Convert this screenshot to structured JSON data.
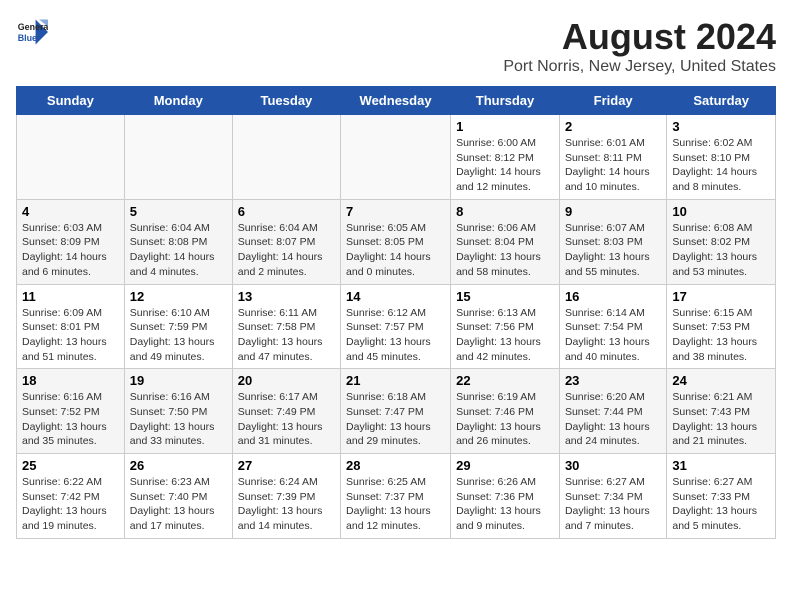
{
  "header": {
    "logo_line1": "General",
    "logo_line2": "Blue",
    "title": "August 2024",
    "subtitle": "Port Norris, New Jersey, United States"
  },
  "weekdays": [
    "Sunday",
    "Monday",
    "Tuesday",
    "Wednesday",
    "Thursday",
    "Friday",
    "Saturday"
  ],
  "weeks": [
    [
      {
        "day": "",
        "info": ""
      },
      {
        "day": "",
        "info": ""
      },
      {
        "day": "",
        "info": ""
      },
      {
        "day": "",
        "info": ""
      },
      {
        "day": "1",
        "info": "Sunrise: 6:00 AM\nSunset: 8:12 PM\nDaylight: 14 hours\nand 12 minutes."
      },
      {
        "day": "2",
        "info": "Sunrise: 6:01 AM\nSunset: 8:11 PM\nDaylight: 14 hours\nand 10 minutes."
      },
      {
        "day": "3",
        "info": "Sunrise: 6:02 AM\nSunset: 8:10 PM\nDaylight: 14 hours\nand 8 minutes."
      }
    ],
    [
      {
        "day": "4",
        "info": "Sunrise: 6:03 AM\nSunset: 8:09 PM\nDaylight: 14 hours\nand 6 minutes."
      },
      {
        "day": "5",
        "info": "Sunrise: 6:04 AM\nSunset: 8:08 PM\nDaylight: 14 hours\nand 4 minutes."
      },
      {
        "day": "6",
        "info": "Sunrise: 6:04 AM\nSunset: 8:07 PM\nDaylight: 14 hours\nand 2 minutes."
      },
      {
        "day": "7",
        "info": "Sunrise: 6:05 AM\nSunset: 8:05 PM\nDaylight: 14 hours\nand 0 minutes."
      },
      {
        "day": "8",
        "info": "Sunrise: 6:06 AM\nSunset: 8:04 PM\nDaylight: 13 hours\nand 58 minutes."
      },
      {
        "day": "9",
        "info": "Sunrise: 6:07 AM\nSunset: 8:03 PM\nDaylight: 13 hours\nand 55 minutes."
      },
      {
        "day": "10",
        "info": "Sunrise: 6:08 AM\nSunset: 8:02 PM\nDaylight: 13 hours\nand 53 minutes."
      }
    ],
    [
      {
        "day": "11",
        "info": "Sunrise: 6:09 AM\nSunset: 8:01 PM\nDaylight: 13 hours\nand 51 minutes."
      },
      {
        "day": "12",
        "info": "Sunrise: 6:10 AM\nSunset: 7:59 PM\nDaylight: 13 hours\nand 49 minutes."
      },
      {
        "day": "13",
        "info": "Sunrise: 6:11 AM\nSunset: 7:58 PM\nDaylight: 13 hours\nand 47 minutes."
      },
      {
        "day": "14",
        "info": "Sunrise: 6:12 AM\nSunset: 7:57 PM\nDaylight: 13 hours\nand 45 minutes."
      },
      {
        "day": "15",
        "info": "Sunrise: 6:13 AM\nSunset: 7:56 PM\nDaylight: 13 hours\nand 42 minutes."
      },
      {
        "day": "16",
        "info": "Sunrise: 6:14 AM\nSunset: 7:54 PM\nDaylight: 13 hours\nand 40 minutes."
      },
      {
        "day": "17",
        "info": "Sunrise: 6:15 AM\nSunset: 7:53 PM\nDaylight: 13 hours\nand 38 minutes."
      }
    ],
    [
      {
        "day": "18",
        "info": "Sunrise: 6:16 AM\nSunset: 7:52 PM\nDaylight: 13 hours\nand 35 minutes."
      },
      {
        "day": "19",
        "info": "Sunrise: 6:16 AM\nSunset: 7:50 PM\nDaylight: 13 hours\nand 33 minutes."
      },
      {
        "day": "20",
        "info": "Sunrise: 6:17 AM\nSunset: 7:49 PM\nDaylight: 13 hours\nand 31 minutes."
      },
      {
        "day": "21",
        "info": "Sunrise: 6:18 AM\nSunset: 7:47 PM\nDaylight: 13 hours\nand 29 minutes."
      },
      {
        "day": "22",
        "info": "Sunrise: 6:19 AM\nSunset: 7:46 PM\nDaylight: 13 hours\nand 26 minutes."
      },
      {
        "day": "23",
        "info": "Sunrise: 6:20 AM\nSunset: 7:44 PM\nDaylight: 13 hours\nand 24 minutes."
      },
      {
        "day": "24",
        "info": "Sunrise: 6:21 AM\nSunset: 7:43 PM\nDaylight: 13 hours\nand 21 minutes."
      }
    ],
    [
      {
        "day": "25",
        "info": "Sunrise: 6:22 AM\nSunset: 7:42 PM\nDaylight: 13 hours\nand 19 minutes."
      },
      {
        "day": "26",
        "info": "Sunrise: 6:23 AM\nSunset: 7:40 PM\nDaylight: 13 hours\nand 17 minutes."
      },
      {
        "day": "27",
        "info": "Sunrise: 6:24 AM\nSunset: 7:39 PM\nDaylight: 13 hours\nand 14 minutes."
      },
      {
        "day": "28",
        "info": "Sunrise: 6:25 AM\nSunset: 7:37 PM\nDaylight: 13 hours\nand 12 minutes."
      },
      {
        "day": "29",
        "info": "Sunrise: 6:26 AM\nSunset: 7:36 PM\nDaylight: 13 hours\nand 9 minutes."
      },
      {
        "day": "30",
        "info": "Sunrise: 6:27 AM\nSunset: 7:34 PM\nDaylight: 13 hours\nand 7 minutes."
      },
      {
        "day": "31",
        "info": "Sunrise: 6:27 AM\nSunset: 7:33 PM\nDaylight: 13 hours\nand 5 minutes."
      }
    ]
  ]
}
